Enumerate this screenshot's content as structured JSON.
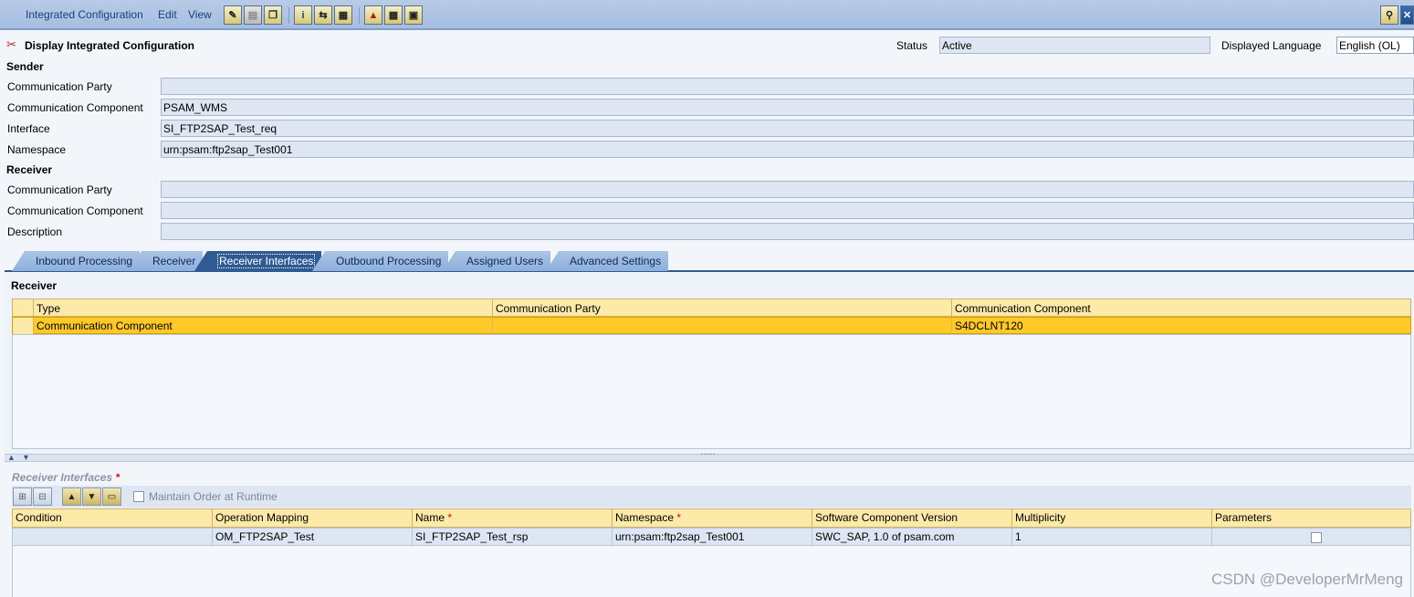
{
  "menu": {
    "items": [
      "Integrated Configuration",
      "Edit",
      "View"
    ]
  },
  "header": {
    "title": "Display Integrated Configuration",
    "status_label": "Status",
    "status_value": "Active",
    "language_label": "Displayed Language",
    "language_value": "English (OL)"
  },
  "sender": {
    "heading": "Sender",
    "party_label": "Communication Party",
    "party_value": "",
    "component_label": "Communication Component",
    "component_value": "PSAM_WMS",
    "interface_label": "Interface",
    "interface_value": "SI_FTP2SAP_Test_req",
    "namespace_label": "Namespace",
    "namespace_value": "urn:psam:ftp2sap_Test001"
  },
  "receiver": {
    "heading": "Receiver",
    "party_label": "Communication Party",
    "party_value": "",
    "component_label": "Communication Component",
    "component_value": "",
    "description_label": "Description",
    "description_value": ""
  },
  "tabs": [
    "Inbound Processing",
    "Receiver",
    "Receiver Interfaces",
    "Outbound Processing",
    "Assigned Users",
    "Advanced Settings"
  ],
  "receiver_table": {
    "title": "Receiver",
    "columns": [
      "Type",
      "Communication Party",
      "Communication Component"
    ],
    "rows": [
      {
        "type": "Communication Component",
        "party": "",
        "component": "S4DCLNT120"
      }
    ]
  },
  "receiver_interfaces": {
    "title": "Receiver Interfaces",
    "required_mark": "*",
    "maintain_order_label": "Maintain Order at Runtime",
    "columns": [
      "Condition",
      "Operation Mapping",
      "Name",
      "Namespace",
      "Software Component Version",
      "Multiplicity",
      "Parameters"
    ],
    "rows": [
      {
        "condition": "",
        "operation_mapping": "OM_FTP2SAP_Test",
        "name": "SI_FTP2SAP_Test_rsp",
        "namespace": "urn:psam:ftp2sap_Test001",
        "swcv": "SWC_SAP, 1.0 of psam.com",
        "multiplicity": "1"
      }
    ]
  },
  "watermark": "CSDN @DeveloperMrMeng"
}
